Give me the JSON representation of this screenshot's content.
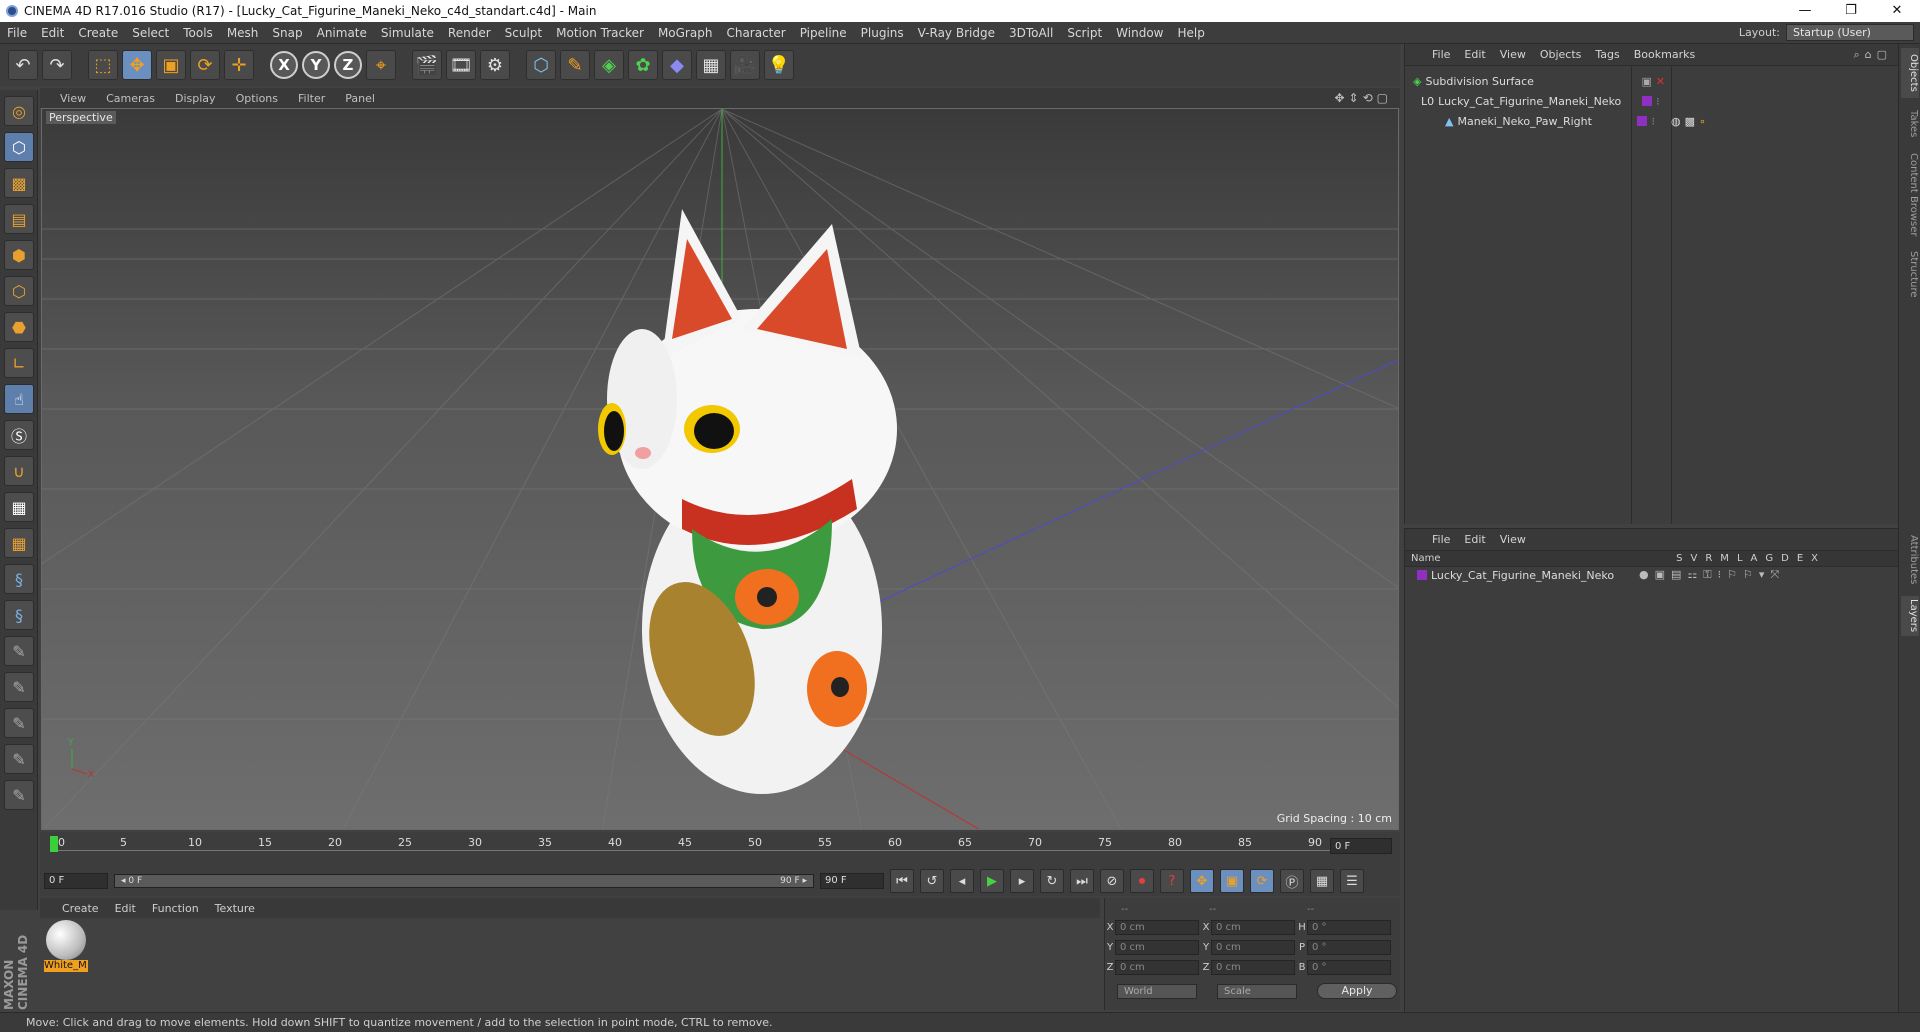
{
  "window": {
    "title": "CINEMA 4D R17.016 Studio (R17) - [Lucky_Cat_Figurine_Maneki_Neko_c4d_standart.c4d] - Main",
    "minimize": "—",
    "maximize": "❐",
    "close": "✕"
  },
  "menu": [
    "File",
    "Edit",
    "Create",
    "Select",
    "Tools",
    "Mesh",
    "Snap",
    "Animate",
    "Simulate",
    "Render",
    "Sculpt",
    "Motion Tracker",
    "MoGraph",
    "Character",
    "Pipeline",
    "Plugins",
    "V-Ray Bridge",
    "3DToAll",
    "Script",
    "Window",
    "Help"
  ],
  "layout": {
    "label": "Layout:",
    "value": "Startup (User)"
  },
  "toolbar": {
    "undo": "↶",
    "redo": "↷",
    "live_select": "⬚",
    "move": "✥",
    "scale": "▣",
    "rotate": "⟳",
    "transform": "✛",
    "x": "X",
    "y": "Y",
    "z": "Z",
    "coord": "⌖",
    "render_view": "🎬",
    "render_pv": "🎞",
    "render_settings": "⚙",
    "cube": "⬡",
    "pen": "✎",
    "subdiv": "◈",
    "cloner": "✿",
    "deformer": "◆",
    "floor": "▦",
    "camera": "🎥",
    "light": "💡"
  },
  "viewport": {
    "menu": [
      "View",
      "Cameras",
      "Display",
      "Options",
      "Filter",
      "Panel"
    ],
    "label": "Perspective",
    "grid_spacing": "Grid Spacing : 10 cm",
    "icons": "✥⇕⟲▢"
  },
  "timeline": {
    "ticks": [
      "0",
      "5",
      "10",
      "15",
      "20",
      "25",
      "30",
      "35",
      "40",
      "45",
      "50",
      "55",
      "60",
      "65",
      "70",
      "75",
      "80",
      "85",
      "90"
    ],
    "current": "0 F"
  },
  "transport": {
    "start": "0 F",
    "slider_start": "◂ 0 F",
    "slider_end": "90 F ▸",
    "end": "90 F"
  },
  "materials": {
    "menu": [
      "Create",
      "Edit",
      "Function",
      "Texture"
    ],
    "items": [
      "White_M"
    ]
  },
  "coords": {
    "rows": [
      {
        "a": "X",
        "av": "0 cm",
        "b": "X",
        "bv": "0 cm",
        "c": "H",
        "cv": "0 °"
      },
      {
        "a": "Y",
        "av": "0 cm",
        "b": "Y",
        "bv": "0 cm",
        "c": "P",
        "cv": "0 °"
      },
      {
        "a": "Z",
        "av": "0 cm",
        "b": "Z",
        "bv": "0 cm",
        "c": "B",
        "cv": "0 °"
      }
    ],
    "mode": "World",
    "scale": "Scale",
    "apply": "Apply",
    "head1": "--",
    "head2": "--",
    "head3": "--"
  },
  "objects": {
    "menu": [
      "File",
      "Edit",
      "View",
      "Objects",
      "Tags",
      "Bookmarks"
    ],
    "items": [
      {
        "name": "Subdivision Surface",
        "indent": 0
      },
      {
        "name": "Lucky_Cat_Figurine_Maneki_Neko",
        "indent": 1
      },
      {
        "name": "Maneki_Neko_Paw_Right",
        "indent": 2
      }
    ]
  },
  "layers": {
    "menu": [
      "File",
      "Edit",
      "View"
    ],
    "header": "Name",
    "cols": [
      "S",
      "V",
      "R",
      "M",
      "L",
      "A",
      "G",
      "D",
      "E",
      "X"
    ],
    "items": [
      "Lucky_Cat_Figurine_Maneki_Neko"
    ]
  },
  "right_tabs": [
    "Objects",
    "Takes",
    "Content Browser",
    "Structure",
    "Attributes",
    "Layers"
  ],
  "status": "Move: Click and drag to move elements. Hold down SHIFT to quantize movement / add to the selection in point mode, CTRL to remove.",
  "brand": "MAXON CINEMA 4D"
}
